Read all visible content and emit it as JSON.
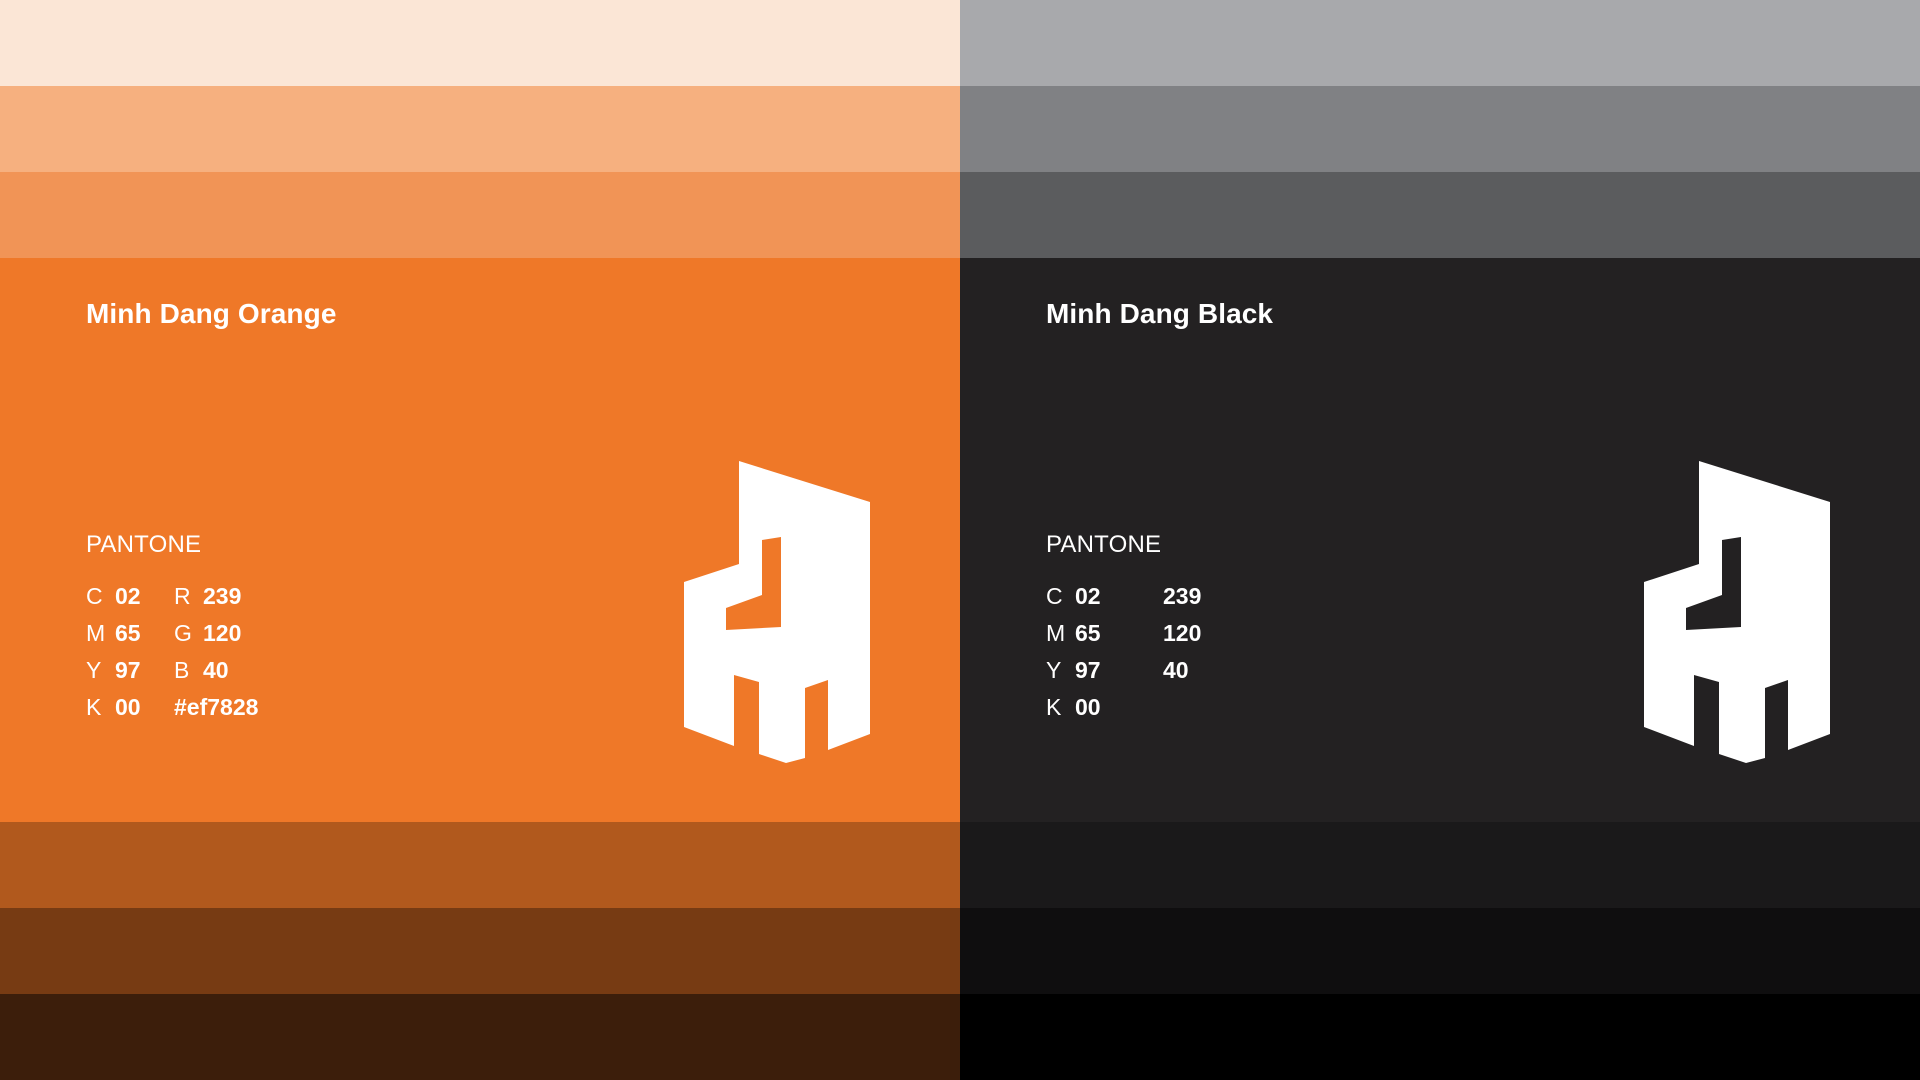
{
  "colors": {
    "orange": {
      "name": "Minh Dang Orange",
      "pantone_label": "PANTONE",
      "main_color": "#ef7828",
      "tints": [
        "#fbe6d6",
        "#f6b07f",
        "#f19456"
      ],
      "shades": [
        "#b1591d",
        "#773b13",
        "#3c1e0b"
      ],
      "cmyk": [
        {
          "letter": "C",
          "value": "02"
        },
        {
          "letter": "M",
          "value": "65"
        },
        {
          "letter": "Y",
          "value": "97"
        },
        {
          "letter": "K",
          "value": "00"
        }
      ],
      "rgb": [
        {
          "letter": "R",
          "value": "239"
        },
        {
          "letter": "G",
          "value": "120"
        },
        {
          "letter": "B",
          "value": "40"
        }
      ],
      "hex": "#ef7828"
    },
    "black": {
      "name": "Minh Dang Black",
      "pantone_label": "PANTONE",
      "main_color": "#232122",
      "tints": [
        "#a8a9ac",
        "#808184",
        "#5b5c5e"
      ],
      "shades": [
        "#1a191a",
        "#0f0e0f",
        "#000000"
      ],
      "cmyk": [
        {
          "letter": "C",
          "value": "02"
        },
        {
          "letter": "M",
          "value": "65"
        },
        {
          "letter": "Y",
          "value": "97"
        },
        {
          "letter": "K",
          "value": "00"
        }
      ],
      "rgb": [
        {
          "value": "239"
        },
        {
          "value": "120"
        },
        {
          "value": "40"
        }
      ]
    }
  },
  "logo": {
    "icon": "chair-logo-icon",
    "color": "#ffffff"
  }
}
